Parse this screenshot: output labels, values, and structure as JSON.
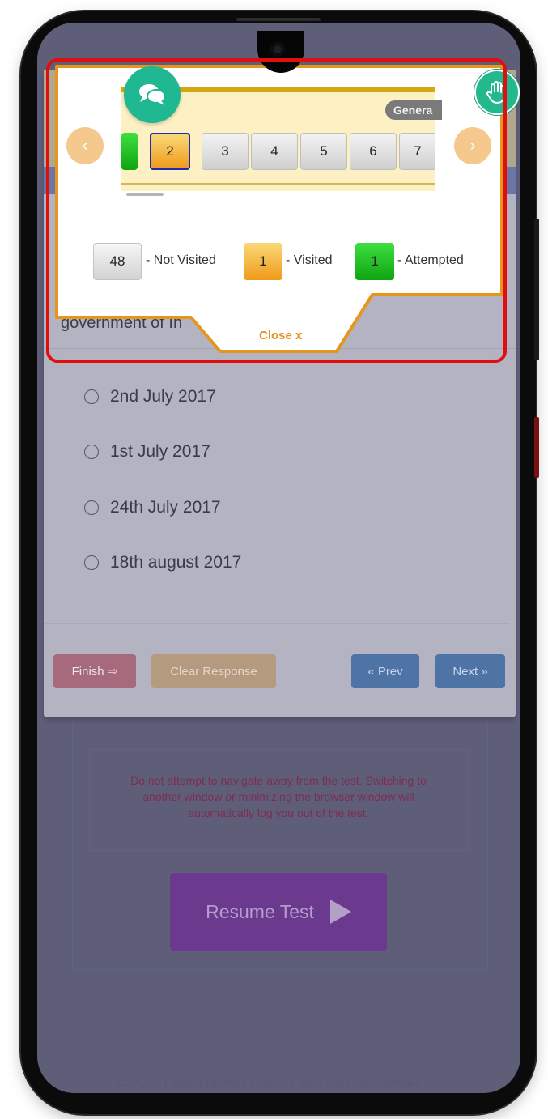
{
  "popup": {
    "section_tag": "Genera",
    "prev_arrow": "‹",
    "next_arrow": "›",
    "question_numbers": [
      {
        "label": "",
        "state": "attempted"
      },
      {
        "label": "2",
        "state": "visited"
      },
      {
        "label": "3",
        "state": "not-visited"
      },
      {
        "label": "4",
        "state": "not-visited"
      },
      {
        "label": "5",
        "state": "not-visited"
      },
      {
        "label": "6",
        "state": "not-visited"
      },
      {
        "label": "7",
        "state": "not-visited"
      }
    ],
    "legend": {
      "not_visited_count": "48",
      "not_visited_label": "- Not Visited",
      "visited_count": "1",
      "visited_label": "- Visited",
      "attempted_count": "1",
      "attempted_label": "- Attempted"
    },
    "close_label": "Close x",
    "chat_icon": "chat-bubbles-icon",
    "hand_icon": "raised-hand-icon"
  },
  "question": {
    "text_partial": "government of In",
    "options": [
      "2nd July 2017",
      "1st July 2017",
      "24th July 2017",
      "18th august 2017"
    ]
  },
  "actions": {
    "finish": "Finish ⇨",
    "clear": "Clear Response",
    "prev": "« Prev",
    "next": "Next »"
  },
  "lower": {
    "notice": "Do not attempt to navigate away from the test. Switching to another window or minimizing the browser window will automatically log you out of the test.",
    "resume": "Resume Test"
  },
  "footer": {
    "text": "© 2023 CareerTantra | Use of Open Source Software"
  },
  "colors": {
    "accent_orange": "#e6951d",
    "attempted_green": "#10a312",
    "visited_orange": "#f09a1a",
    "highlight_red": "#e10e0e",
    "chat_green": "#1fb892",
    "resume_purple": "#6b3a8f"
  }
}
